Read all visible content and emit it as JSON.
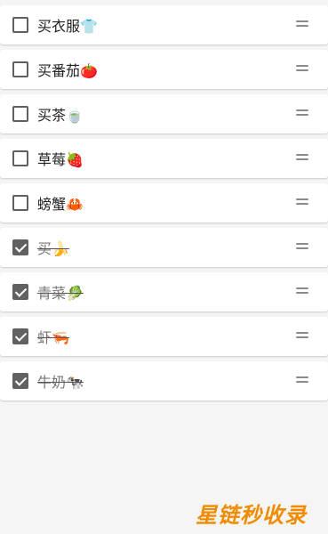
{
  "items": [
    {
      "label": "买衣服👕",
      "checked": false
    },
    {
      "label": "买番茄🍅",
      "checked": false
    },
    {
      "label": "买茶🍵",
      "checked": false
    },
    {
      "label": "草莓🍓",
      "checked": false
    },
    {
      "label": "螃蟹🦀",
      "checked": false
    },
    {
      "label": "买🍌",
      "checked": true
    },
    {
      "label": "青菜🥬",
      "checked": true
    },
    {
      "label": "虾🦐",
      "checked": true
    },
    {
      "label": "牛奶🐄",
      "checked": true
    }
  ],
  "watermark": "星链秒收录",
  "colors": {
    "background": "#f5f5f5",
    "card": "#ffffff",
    "checkbox_checked": "#616161",
    "watermark": "#f08c00"
  },
  "icons": {
    "checkbox": "checkbox-icon",
    "drag_handle": "drag-handle-icon"
  }
}
